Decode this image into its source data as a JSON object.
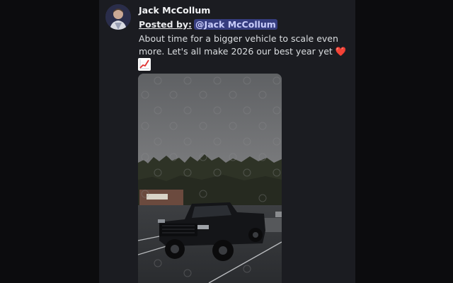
{
  "post": {
    "author": "Jack McCollum",
    "posted_by_label": "Posted by:",
    "mention": "@Jack McCollum",
    "message_line1": "About time for a bigger vehicle to scale even",
    "message_line2": "more. Let's all make 2026 our best year yet",
    "heart_emoji": "❤️",
    "chart_emoji": "chart-increasing-icon"
  },
  "colors": {
    "background": "#0c0c0e",
    "panel": "#1b1c21",
    "mention_bg": "#5865f2",
    "heart": "#e03131",
    "trend_line": "#e03131"
  }
}
